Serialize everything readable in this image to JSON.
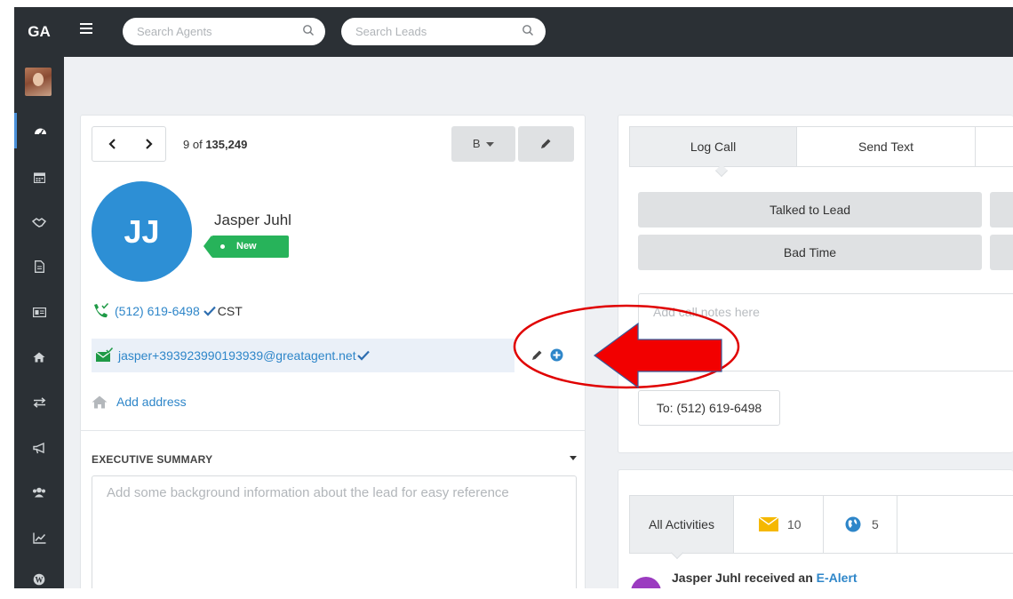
{
  "app": {
    "logo_text": "GA"
  },
  "header": {
    "search_agents_placeholder": "Search Agents",
    "search_leads_placeholder": "Search Leads"
  },
  "sidebar": {
    "items": [
      {
        "name": "dashboard",
        "icon": "dashboard-icon",
        "active": true
      },
      {
        "name": "calendar",
        "icon": "calendar-icon"
      },
      {
        "name": "deals",
        "icon": "handshake-icon"
      },
      {
        "name": "documents",
        "icon": "document-icon"
      },
      {
        "name": "contacts",
        "icon": "id-card-icon"
      },
      {
        "name": "properties",
        "icon": "home-icon"
      },
      {
        "name": "transfers",
        "icon": "exchange-icon"
      },
      {
        "name": "campaigns",
        "icon": "bullhorn-icon"
      },
      {
        "name": "team",
        "icon": "users-icon"
      },
      {
        "name": "reports",
        "icon": "line-chart-icon"
      },
      {
        "name": "wordpress",
        "icon": "wordpress-icon"
      }
    ]
  },
  "lead": {
    "position": "9",
    "position_of": "of",
    "total": "135,249",
    "grade_button": "B",
    "initials": "JJ",
    "name": "Jasper Juhl",
    "status": "New",
    "phone": "(512) 619-6498",
    "timezone": "CST",
    "email": "jasper+393923990193939@greatagent.net",
    "address_link": "Add address"
  },
  "executive_summary": {
    "title": "EXECUTIVE SUMMARY",
    "placeholder": "Add some background information about the lead for easy reference"
  },
  "call_panel": {
    "tabs": [
      "Log Call",
      "Send Text"
    ],
    "active_tab": "Log Call",
    "outcomes": [
      "Talked to Lead",
      "Bad Time"
    ],
    "notes_placeholder": "Add call notes here",
    "to_label": "To: (512) 619-6498"
  },
  "activity_panel": {
    "tabs": {
      "all": "All Activities",
      "email_count": "10",
      "web_count": "5"
    },
    "entry": {
      "actor": "Jasper Juhl",
      "verb": "received an",
      "link": "E-Alert"
    }
  },
  "colors": {
    "sidebar_bg": "#2b3035",
    "accent_blue": "#2d8fd5",
    "status_green": "#27b35a",
    "annotation_red": "#e00000"
  }
}
